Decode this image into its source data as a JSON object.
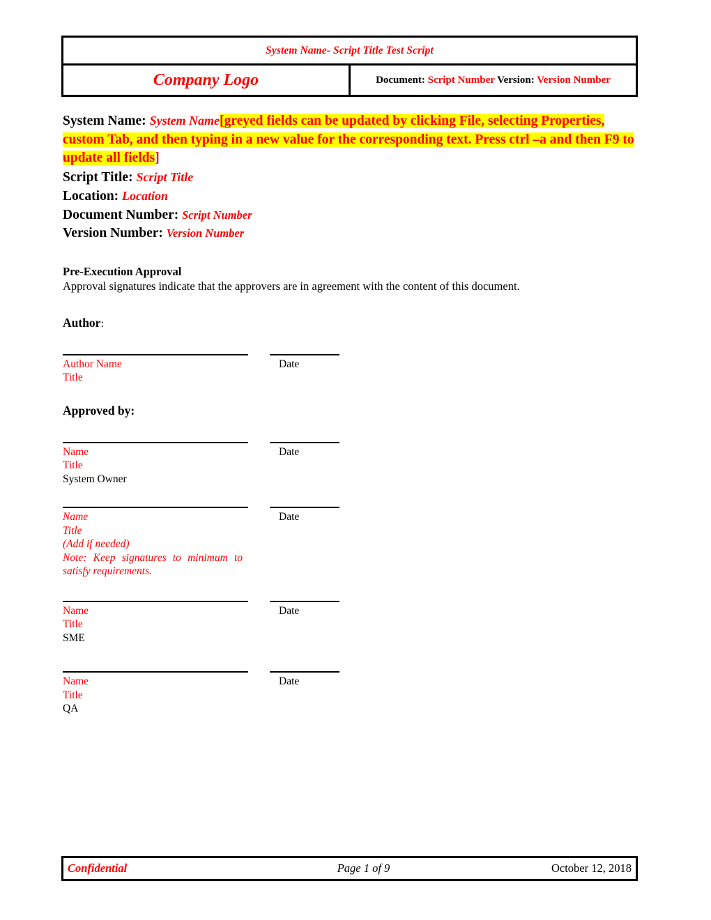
{
  "header": {
    "title_line": "System Name- Script Title Test Script",
    "logo_text": "Company Logo",
    "doc_label": "Document:",
    "doc_value": "Script Number",
    "version_label": "Version:",
    "version_value": "Version Number"
  },
  "title_block": {
    "system_name_label": "System Name:",
    "system_name_value": "System Name",
    "highlight_open_bracket": "[",
    "highlight_text": "greyed fields can be updated by clicking File, selecting Properties, custom Tab, and then typing in a new value for the corresponding text.  Press ctrl –a and then F9 to update all fields",
    "highlight_close_bracket": "]",
    "script_title_label": "Script Title:",
    "script_title_value": "Script Title",
    "location_label": "Location:",
    "location_value": "Location",
    "document_number_label": "Document Number:",
    "document_number_value": "Script Number",
    "version_number_label": "Version Number:",
    "version_number_value": "Version Number"
  },
  "approval": {
    "section_heading": "Pre-Execution Approval",
    "intro_text": "Approval signatures indicate that the approvers are in agreement with the content of this document.",
    "author_heading": "Author",
    "author_colon": ":",
    "approved_by_heading": "Approved by:",
    "date_label": "Date",
    "signatures": [
      {
        "name": "Author Name",
        "title": "Title",
        "role": "",
        "extra_lines": [],
        "italic": false,
        "date": "Date"
      },
      {
        "name": "Name",
        "title": "Title",
        "role": "System Owner",
        "extra_lines": [],
        "italic": false,
        "date": "Date"
      },
      {
        "name": "Name",
        "title": "Title",
        "role": "",
        "extra_lines": [
          "(Add if needed)",
          "Note: Keep signatures to minimum to satisfy requirements."
        ],
        "italic": true,
        "date": "Date"
      },
      {
        "name": "Name",
        "title": "Title",
        "role": "SME",
        "extra_lines": [],
        "italic": false,
        "date": "Date"
      },
      {
        "name": "Name",
        "title": "Title",
        "role": "QA",
        "extra_lines": [],
        "italic": false,
        "date": "Date"
      }
    ]
  },
  "footer": {
    "left": "Confidential",
    "center": "Page 1 of 9",
    "right": "October 12, 2018"
  },
  "colors": {
    "accent_red": "#ff0000",
    "highlight_yellow": "#ffff00",
    "text_black": "#000000"
  }
}
